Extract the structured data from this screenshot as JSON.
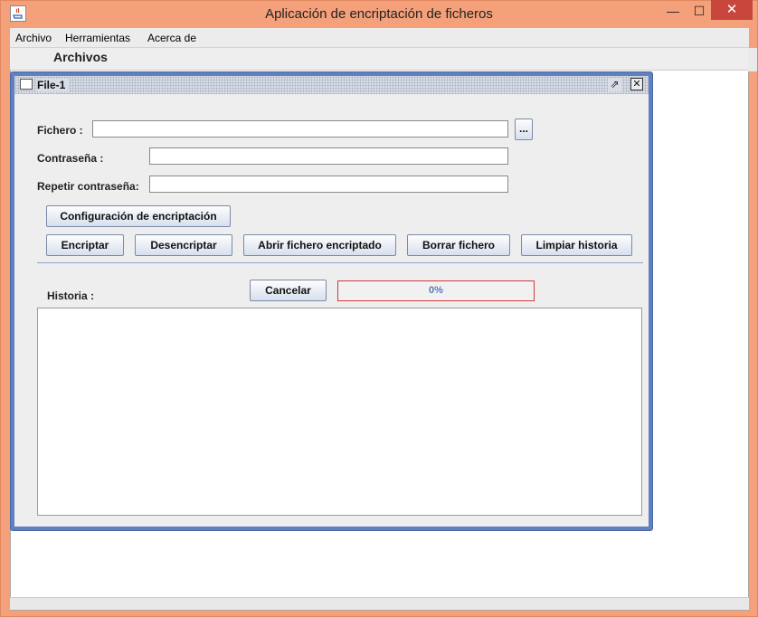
{
  "window": {
    "title": "Aplicación de encriptación de ficheros",
    "minimize_glyph": "—",
    "maximize_glyph": "☐",
    "close_glyph": "✕"
  },
  "menu": {
    "items": [
      {
        "label": "Archivo"
      },
      {
        "label": "Herramientas"
      },
      {
        "label": "Acerca de"
      }
    ]
  },
  "desktop": {
    "title": "Archivos"
  },
  "internal_frame": {
    "title": "File-1",
    "maximize_glyph": "⇗",
    "close_glyph": "✕"
  },
  "form": {
    "fichero_label": "Fichero :",
    "fichero_value": "",
    "browse_label": "...",
    "password_label": "Contraseña :",
    "password_value": "",
    "repeat_label": "Repetir contraseña:",
    "repeat_value": ""
  },
  "buttons": {
    "config": "Configuración de encriptación",
    "encrypt": "Encriptar",
    "decrypt": "Desencriptar",
    "open_encrypted": "Abrir fichero encriptado",
    "delete_file": "Borrar fichero",
    "clear_history": "Limpiar historia",
    "cancel": "Cancelar"
  },
  "history": {
    "label": "Historia :",
    "value": ""
  },
  "progress": {
    "text": "0%",
    "value": 0
  },
  "icons": {
    "app": "java-icon",
    "frame": "window-icon"
  },
  "colors": {
    "title_bar": "#f4a07a",
    "close_button": "#c9463d",
    "frame_border": "#6080c0",
    "progress_border": "#d23a3a",
    "progress_text": "#5a78b8"
  }
}
